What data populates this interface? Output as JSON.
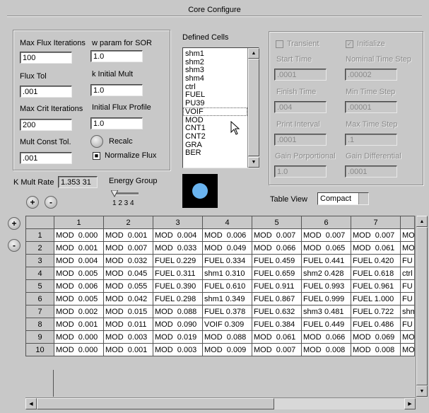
{
  "window": {
    "title": "Core Configure"
  },
  "params": {
    "max_flux_iterations": {
      "label": "Max Flux Iterations",
      "value": "100"
    },
    "w_param": {
      "label": "w param for SOR",
      "value": "1.0"
    },
    "flux_tol": {
      "label": "Flux Tol",
      "value": ".001"
    },
    "k_initial_mult": {
      "label": "k Initial Mult",
      "value": "1.0"
    },
    "max_crit_iterations": {
      "label": "Max Crit Iterations",
      "value": "200"
    },
    "initial_flux_profile": {
      "label": "Initial Flux Profile",
      "value": "1.0"
    },
    "mult_const_tol": {
      "label": "Mult Const Tol.",
      "value": ".001"
    },
    "recalc_label": "Recalc",
    "normalize_flux": {
      "label": "Normalize Flux",
      "checked": true
    }
  },
  "defined_cells": {
    "label": "Defined Cells",
    "items": [
      "shm1",
      "shm2",
      "shm3",
      "shm4",
      "ctrl",
      "FUEL",
      "PU39",
      "VOIF",
      "MOD",
      "CNT1",
      "CNT2",
      "GRA",
      "BER"
    ],
    "selected": "VOIF"
  },
  "transient": {
    "transient_label": "Transient",
    "transient_checked": false,
    "initialize_label": "Initialize",
    "initialize_checked": true,
    "start_time": {
      "label": "Start Time",
      "value": ".0001"
    },
    "nominal_time_step": {
      "label": "Nominal Time Step",
      "value": ".00002"
    },
    "finish_time": {
      "label": "Finish Time",
      "value": ".004"
    },
    "min_time_step": {
      "label": "Min Time Step",
      "value": ".00001"
    },
    "print_interval": {
      "label": "Print Interval",
      "value": ".0001"
    },
    "max_time_step": {
      "label": "Max Time Step",
      "value": ".1"
    },
    "gain_proportional": {
      "label": "Gain Porportional",
      "value": "1.0"
    },
    "gain_differential": {
      "label": "Gain Differential",
      "value": ".0001"
    }
  },
  "k_mult_rate": {
    "label": "K Mult Rate",
    "value": "1.353 31"
  },
  "energy_group": {
    "label": "Energy Group",
    "ticks": "1 2 3 4"
  },
  "table_view": {
    "label": "Table View",
    "selected": "Compact"
  },
  "colors": {
    "indicator": "#6ab4f0",
    "panel": "#c8c8c8"
  },
  "zoom": {
    "plus": "+",
    "minus": "-"
  },
  "grid": {
    "columns": [
      "1",
      "2",
      "3",
      "4",
      "5",
      "6",
      "7"
    ],
    "partial_column": "",
    "rows": [
      {
        "n": "1",
        "cells": [
          "MOD  0.000",
          "MOD  0.001",
          "MOD  0.004",
          "MOD  0.006",
          "MOD  0.007",
          "MOD  0.007",
          "MOD  0.007"
        ],
        "overflow": "MO"
      },
      {
        "n": "2",
        "cells": [
          "MOD  0.001",
          "MOD  0.007",
          "MOD  0.033",
          "MOD  0.049",
          "MOD  0.066",
          "MOD  0.065",
          "MOD  0.061"
        ],
        "overflow": "MO"
      },
      {
        "n": "3",
        "cells": [
          "MOD  0.004",
          "MOD  0.032",
          "FUEL 0.229",
          "FUEL 0.334",
          "FUEL 0.459",
          "FUEL 0.441",
          "FUEL 0.420"
        ],
        "overflow": "FU"
      },
      {
        "n": "4",
        "cells": [
          "MOD  0.005",
          "MOD  0.045",
          "FUEL 0.311",
          "shm1 0.310",
          "FUEL 0.659",
          "shm2 0.428",
          "FUEL 0.618"
        ],
        "overflow": "ctrl ("
      },
      {
        "n": "5",
        "cells": [
          "MOD  0.006",
          "MOD  0.055",
          "FUEL 0.390",
          "FUEL 0.610",
          "FUEL 0.911",
          "FUEL 0.993",
          "FUEL 0.961"
        ],
        "overflow": "FU"
      },
      {
        "n": "6",
        "cells": [
          "MOD  0.005",
          "MOD  0.042",
          "FUEL 0.298",
          "shm1 0.349",
          "FUEL 0.867",
          "FUEL 0.999",
          "FUEL 1.000"
        ],
        "overflow": "FU"
      },
      {
        "n": "7",
        "cells": [
          "MOD  0.002",
          "MOD  0.015",
          "MOD  0.088",
          "FUEL 0.378",
          "FUEL 0.632",
          "shm3 0.481",
          "FUEL 0.722"
        ],
        "overflow": "shm"
      },
      {
        "n": "8",
        "cells": [
          "MOD  0.001",
          "MOD  0.011",
          "MOD  0.090",
          "VOIF 0.309",
          "FUEL 0.384",
          "FUEL 0.449",
          "FUEL 0.486"
        ],
        "overflow": "FU"
      },
      {
        "n": "9",
        "cells": [
          "MOD  0.000",
          "MOD  0.003",
          "MOD  0.019",
          "MOD  0.088",
          "MOD  0.061",
          "MOD  0.066",
          "MOD  0.069"
        ],
        "overflow": "MO"
      },
      {
        "n": "10",
        "cells": [
          "MOD  0.000",
          "MOD  0.001",
          "MOD  0.003",
          "MOD  0.009",
          "MOD  0.007",
          "MOD  0.008",
          "MOD  0.008"
        ],
        "overflow": "MO"
      }
    ]
  }
}
